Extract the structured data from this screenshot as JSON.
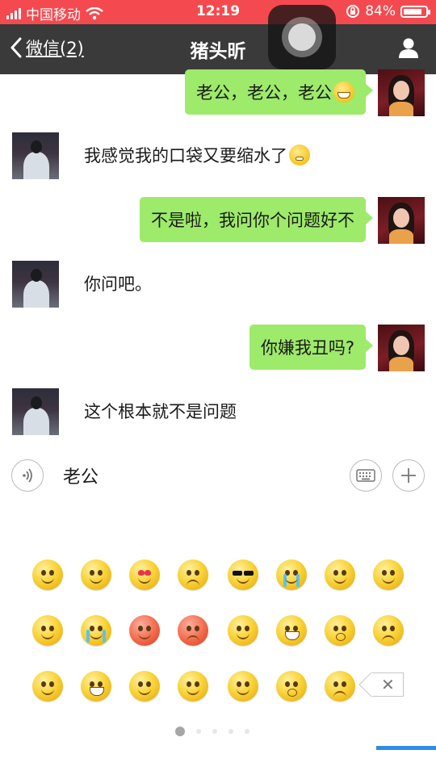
{
  "status_bar": {
    "carrier": "中国移动",
    "time": "12:19",
    "battery_percent": "84%",
    "battery_level": 0.84,
    "icons": [
      "signal-icon",
      "wifi-icon",
      "orientation-lock-icon",
      "battery-icon"
    ]
  },
  "nav": {
    "back_label": "微信(2)",
    "title": "猪头昕",
    "icons": [
      "chevron-left-icon",
      "profile-icon"
    ]
  },
  "messages": [
    {
      "direction": "outgoing",
      "text": "老公，老公，老公",
      "emoji": "grin-emoji"
    },
    {
      "direction": "incoming",
      "text": "我感觉我的口袋又要缩水了",
      "emoji": "eye-roll-emoji"
    },
    {
      "direction": "outgoing",
      "text": "不是啦，我问你个问题好不"
    },
    {
      "direction": "incoming",
      "text": "你问吧。"
    },
    {
      "direction": "outgoing",
      "text": "你嫌我丑吗?"
    },
    {
      "direction": "incoming",
      "text": "这个根本就不是问题"
    }
  ],
  "input": {
    "value": "老公",
    "icons": [
      "voice-icon",
      "keyboard-icon",
      "plus-icon"
    ]
  },
  "emoji_panel": {
    "rows": [
      [
        "smile",
        "awkward",
        "heart-eyes",
        "angry-pout",
        "sunglasses",
        "crying",
        "shy",
        "shush"
      ],
      [
        "sleepy",
        "tearful-laugh",
        "embarrassed",
        "furious",
        "tongue-wink",
        "grin",
        "surprised",
        "sad"
      ],
      [
        "puppy-eyes",
        "cry-laugh",
        "sweating",
        "thinking",
        "blush",
        "shocked",
        "confused"
      ]
    ],
    "delete_icon": "backspace-icon",
    "page_count": 5,
    "active_page": 1
  },
  "colors": {
    "status_bar": "#f44a4f",
    "nav_bar": "#3a3a3a",
    "outgoing_bubble": "#9eea6a",
    "indicator": "#2e8bea"
  }
}
